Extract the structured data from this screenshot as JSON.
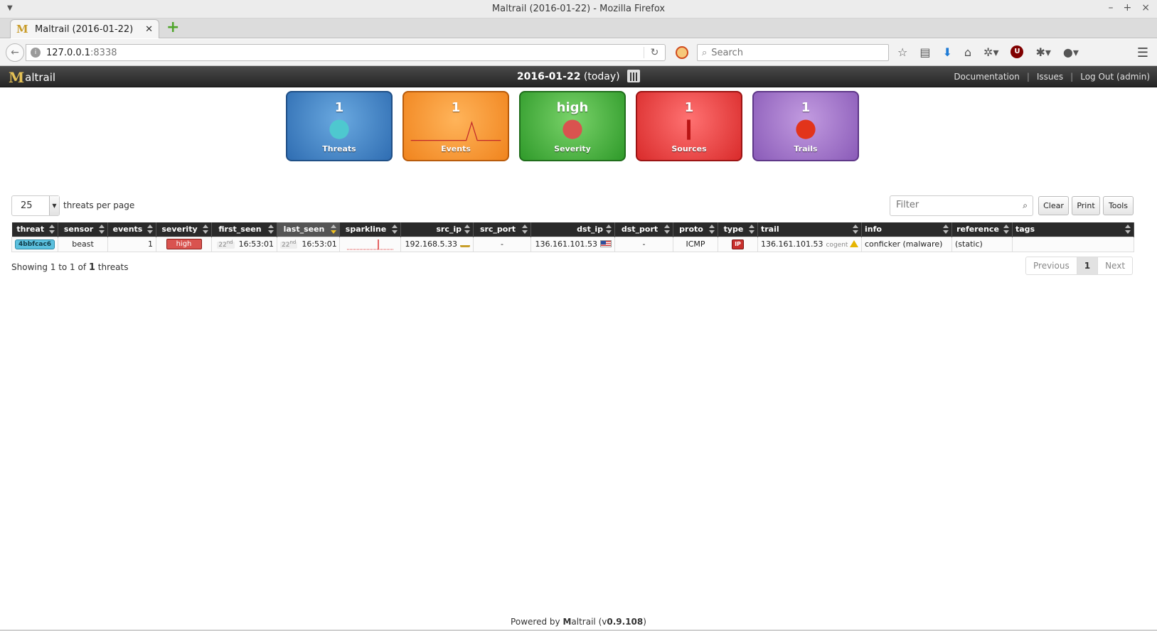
{
  "window": {
    "title": "Maltrail (2016-01-22) - Mozilla Firefox"
  },
  "browser": {
    "tab_title": "Maltrail (2016-01-22)",
    "url_host": "127.0.0.1",
    "url_port": ":8338",
    "search_placeholder": "Search"
  },
  "header": {
    "logo_text": "altrail",
    "date": "2016-01-22",
    "date_suffix": "(today)",
    "links": [
      "Documentation",
      "Issues",
      "Log Out (admin)"
    ]
  },
  "counters": [
    {
      "value": "1",
      "label": "Threats",
      "color": "#3f7fc4"
    },
    {
      "value": "1",
      "label": "Events",
      "color": "#f5922a"
    },
    {
      "value": "high",
      "label": "Severity",
      "color": "#3aa836"
    },
    {
      "value": "1",
      "label": "Sources",
      "color": "#e03a3a"
    },
    {
      "value": "1",
      "label": "Trails",
      "color": "#9b6cc7"
    }
  ],
  "controls": {
    "per_page_value": "25",
    "per_page_label": "threats per page",
    "filter_placeholder": "Filter",
    "buttons": [
      "Clear",
      "Print",
      "Tools"
    ]
  },
  "table": {
    "columns": [
      "threat",
      "sensor",
      "events",
      "severity",
      "first_seen",
      "last_seen",
      "sparkline",
      "src_ip",
      "src_port",
      "dst_ip",
      "dst_port",
      "proto",
      "type",
      "trail",
      "info",
      "reference",
      "tags"
    ],
    "rows": [
      {
        "threat": "4bbfcac6",
        "sensor": "beast",
        "events": "1",
        "severity": "high",
        "first_seen_day": "22",
        "first_seen_suffix": "nd",
        "first_seen_time": "16:53:01",
        "last_seen_day": "22",
        "last_seen_suffix": "nd",
        "last_seen_time": "16:53:01",
        "src_ip": "192.168.5.33",
        "src_port": "-",
        "dst_ip": "136.161.101.53",
        "dst_port": "-",
        "proto": "ICMP",
        "type": "IP",
        "trail": "136.161.101.53",
        "trail_asn": "cogent",
        "info": "conficker (malware)",
        "reference": "(static)",
        "tags": ""
      }
    ]
  },
  "table_info": {
    "prefix": "Showing 1 to 1 of",
    "total": "1",
    "suffix": "threats"
  },
  "pagination": {
    "previous": "Previous",
    "current": "1",
    "next": "Next"
  },
  "footer": {
    "prefix": "Powered by",
    "brand_m": "M",
    "brand_rest": "altrail",
    "version_open": "(v",
    "version": "0.9.108",
    "version_close": ")"
  }
}
